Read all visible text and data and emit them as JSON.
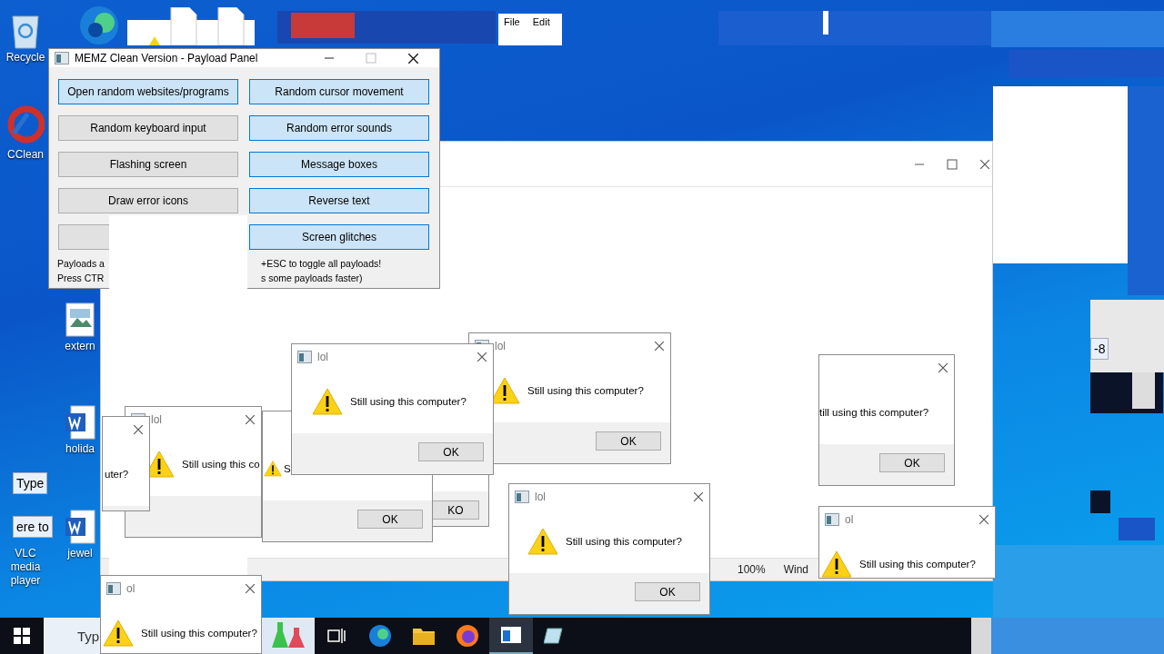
{
  "desktop_icons": [
    {
      "label": "Recycle"
    },
    {
      "label": "CClean"
    },
    {
      "label": "extern"
    },
    {
      "label": "holida"
    },
    {
      "label": "VLC media player"
    },
    {
      "label": "jewel"
    }
  ],
  "glitch_fragments": [
    {
      "text": "Type"
    },
    {
      "text": "ere to"
    },
    {
      "text": "-8"
    }
  ],
  "background_window": {
    "menu": [
      "File",
      "Edit"
    ]
  },
  "explorer_window": {
    "status": [
      "100%",
      "Wind"
    ]
  },
  "payload_panel": {
    "title": "MEMZ Clean Version - Payload Panel",
    "buttons": [
      {
        "label": "Open random websites/programs",
        "enabled": true
      },
      {
        "label": "Random cursor movement",
        "enabled": true
      },
      {
        "label": "Random keyboard input",
        "enabled": false
      },
      {
        "label": "Random error sounds",
        "enabled": true
      },
      {
        "label": "Flashing screen",
        "enabled": false
      },
      {
        "label": "Message boxes",
        "enabled": true
      },
      {
        "label": "Draw error icons",
        "enabled": false
      },
      {
        "label": "Reverse text",
        "enabled": true
      },
      {
        "enabled": false
      },
      {
        "label": "Screen glitches",
        "enabled": true
      }
    ],
    "footer_left": [
      "Payloads a",
      "Press CTR"
    ],
    "footer_right": [
      "+ESC to toggle all payloads!",
      "s some payloads faster)"
    ]
  },
  "dialogs": [
    {
      "button": "KO",
      "warning_icon": false
    },
    {
      "message": "S",
      "button": "OK",
      "warning_icon": true
    },
    {
      "title": "lol",
      "message": "Still using this computer?",
      "button": "OK",
      "warning_icon": true
    },
    {
      "title": "lol",
      "message": "Still using this computer?",
      "button": "OK",
      "warning_icon": true
    },
    {
      "title": "lol",
      "message": "Still using this co",
      "warning_icon": true
    },
    {
      "message": "uter?",
      "warning_icon": false
    },
    {
      "title": "lol",
      "message": "Still using this computer?",
      "button": "OK",
      "warning_icon": true
    },
    {
      "message": "till using this computer?",
      "button": "OK",
      "warning_icon": false
    },
    {
      "title": "ol",
      "message": "Still using this computer?",
      "warning_icon": true
    },
    {
      "title": "ol",
      "message": "Still using this computer?",
      "warning_icon": true
    }
  ],
  "taskbar": {
    "search": "Typ"
  }
}
